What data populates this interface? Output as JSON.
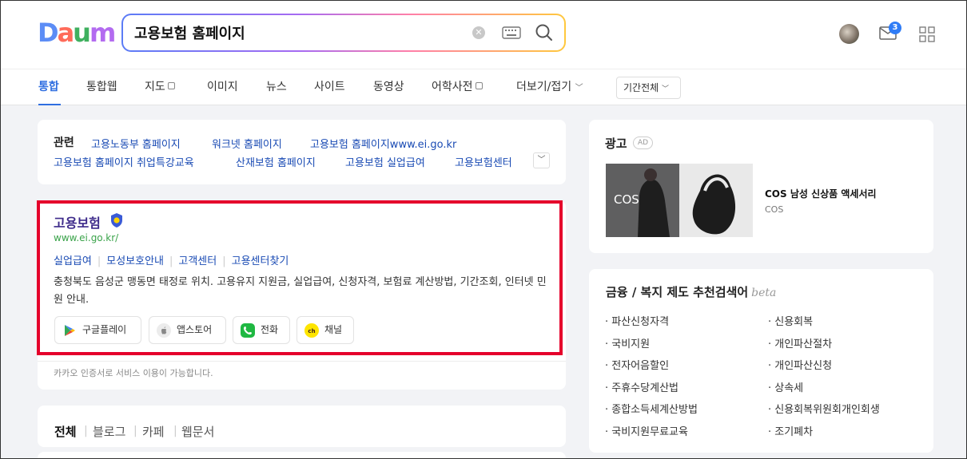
{
  "header": {
    "logo": [
      "D",
      "a",
      "u",
      "m"
    ],
    "search_value": "고용보험 홈페이지",
    "mail_count": "3"
  },
  "tabs": [
    "통합",
    "통합웹",
    "지도",
    "이미지",
    "뉴스",
    "사이트",
    "동영상",
    "어학사전",
    "더보기/접기"
  ],
  "period_filter": "기간전체",
  "related": {
    "label": "관련",
    "links": [
      "고용노동부 홈페이지",
      "워크넷 홈페이지",
      "고용보험 홈페이지www.ei.go.kr",
      "고용보험 홈페이지 취업특강교육",
      "산재보험 홈페이지",
      "고용보험 실업급여",
      "고용보험센터"
    ]
  },
  "site_result": {
    "title": "고용보험",
    "url": "www.ei.go.kr/",
    "sublinks": [
      "실업급여",
      "모성보호안내",
      "고객센터",
      "고용센터찾기"
    ],
    "description": "충청북도 음성군 맹동면 태정로 위치. 고용유지 지원금, 실업급여, 신청자격, 보험료 계산방법, 기간조회, 인터넷 민원 안내.",
    "apps": [
      "구글플레이",
      "앱스토어",
      "전화",
      "채널"
    ],
    "kakao_note": "카카오 인증서로 서비스 이용이 가능합니다."
  },
  "filters": [
    "전체",
    "블로그",
    "카페",
    "웹문서"
  ],
  "ad": {
    "label": "광고",
    "badge": "AD",
    "image_text": "COS",
    "product": "COS 남성 신상품 액세서리",
    "brand": "COS"
  },
  "finance": {
    "title": "금융 / 복지 제도 추천검색어",
    "beta": "beta",
    "left": [
      "· 파산신청자격",
      "· 국비지원",
      "· 전자어음할인",
      "· 주휴수당계산법",
      "· 종합소득세계산방법",
      "· 국비지원무료교육"
    ],
    "right": [
      "· 신용회복",
      "· 개인파산절차",
      "· 개인파산신청",
      "· 상속세",
      "· 신용회복위원회개인회생",
      "· 조기폐차"
    ]
  },
  "colors": {
    "accent": "#2f6ee0",
    "highlight": "#e5002b",
    "url_green": "#3aa34a"
  }
}
